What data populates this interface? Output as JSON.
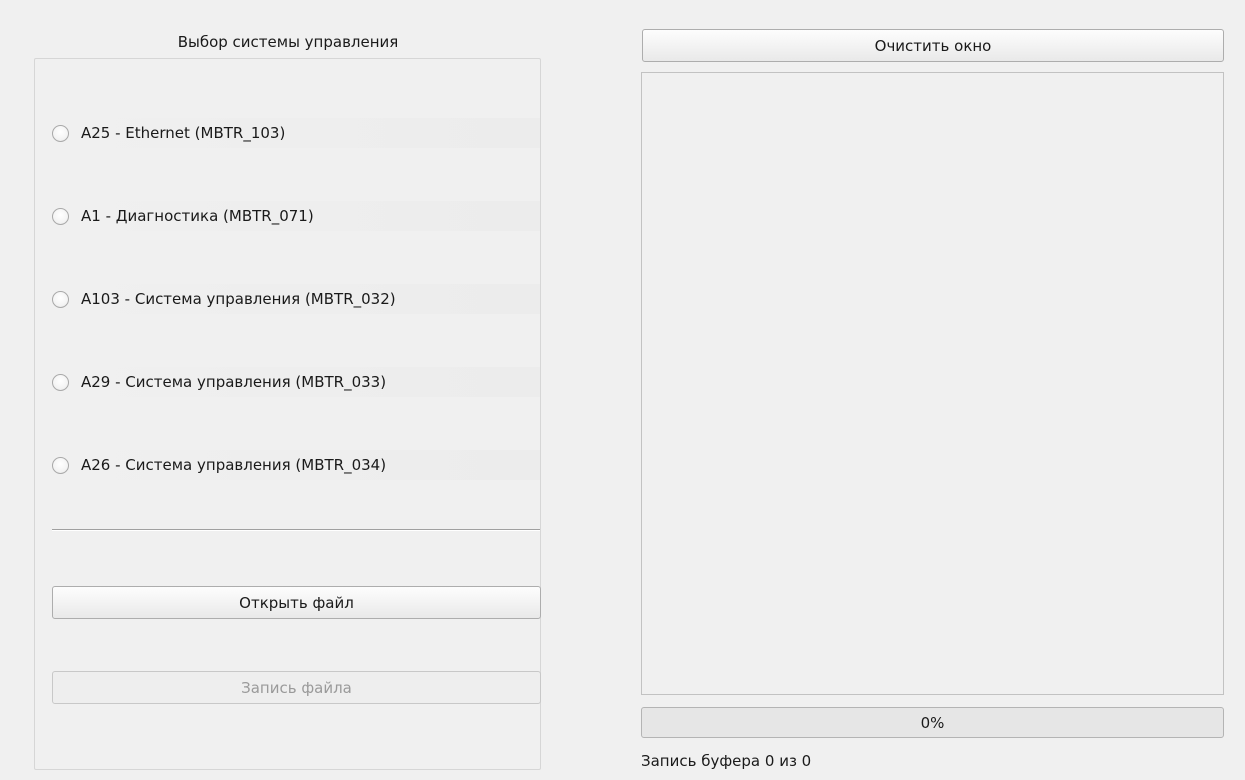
{
  "left_panel": {
    "group_title": "Выбор системы управления",
    "radio_options": [
      {
        "label": "A25 - Ethernet (MBTR_103)",
        "checked": false
      },
      {
        "label": "A1 - Диагностика (MBTR_071)",
        "checked": false
      },
      {
        "label": "A103 - Система управления (MBTR_032)",
        "checked": false
      },
      {
        "label": "A29 - Система управления (MBTR_033)",
        "checked": false
      },
      {
        "label": "A26 - Система управления (MBTR_034)",
        "checked": false
      }
    ],
    "open_file_label": "Открыть файл",
    "write_file_label": "Запись файла"
  },
  "right_panel": {
    "clear_window_label": "Очистить окно",
    "log_text": "",
    "progress": {
      "value": 0,
      "text": "0%"
    },
    "status_text": "Запись буфера 0 из 0"
  },
  "colors": {
    "window_bg": "#f0f0f0",
    "progress_fill": "#06b025"
  }
}
